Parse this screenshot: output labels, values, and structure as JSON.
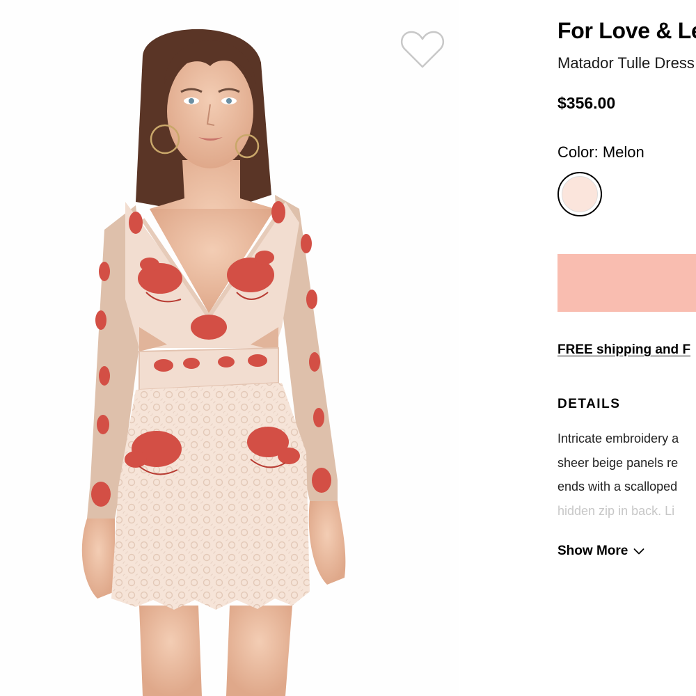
{
  "product": {
    "brand": "For Love & Lemons",
    "name": "Matador Tulle Dress",
    "price": "$356.00"
  },
  "color": {
    "label": "Color:",
    "selected": "Melon",
    "swatch_hex": "#fbe5dc"
  },
  "actions": {
    "add_to_bag_color": "#f9bdb0",
    "shipping_link": "FREE shipping and F"
  },
  "details": {
    "heading": "DETAILS",
    "lines": [
      "Intricate embroidery a",
      "sheer beige panels re",
      "ends with a scalloped",
      "hidden zip in back. Li"
    ],
    "show_more": "Show More"
  },
  "icons": {
    "wishlist": "heart-outline-icon",
    "show_more": "chevron-down-icon"
  }
}
